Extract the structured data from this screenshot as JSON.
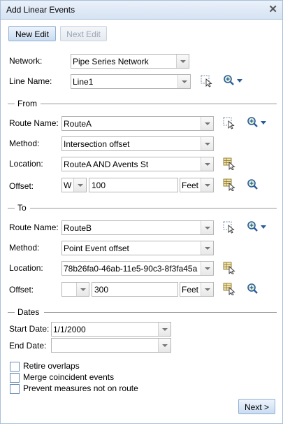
{
  "window": {
    "title": "Add Linear Events"
  },
  "toolbar": {
    "new_edit": "New Edit",
    "next_edit": "Next Edit"
  },
  "network": {
    "label": "Network:",
    "value": "Pipe Series Network"
  },
  "line": {
    "label": "Line Name:",
    "value": "Line1"
  },
  "from": {
    "title": "From",
    "route_label": "Route Name:",
    "route_value": "RouteA",
    "method_label": "Method:",
    "method_value": "Intersection offset",
    "location_label": "Location:",
    "location_value": "RouteA AND Avents St",
    "offset_label": "Offset:",
    "direction": "W",
    "offset_value": "100",
    "units": "Feet"
  },
  "to": {
    "title": "To",
    "route_label": "Route Name:",
    "route_value": "RouteB",
    "method_label": "Method:",
    "method_value": "Point Event offset",
    "location_label": "Location:",
    "location_value": "78b26fa0-46ab-11e5-90c3-8f3fa45a",
    "offset_label": "Offset:",
    "direction": "",
    "offset_value": "300",
    "units": "Feet"
  },
  "dates": {
    "title": "Dates",
    "start_label": "Start Date:",
    "start_value": "1/1/2000",
    "end_label": "End Date:",
    "end_value": ""
  },
  "options": {
    "retire_overlaps": "Retire overlaps",
    "merge_coincident": "Merge coincident events",
    "prevent_measures": "Prevent measures not on route"
  },
  "footer": {
    "next": "Next >"
  }
}
